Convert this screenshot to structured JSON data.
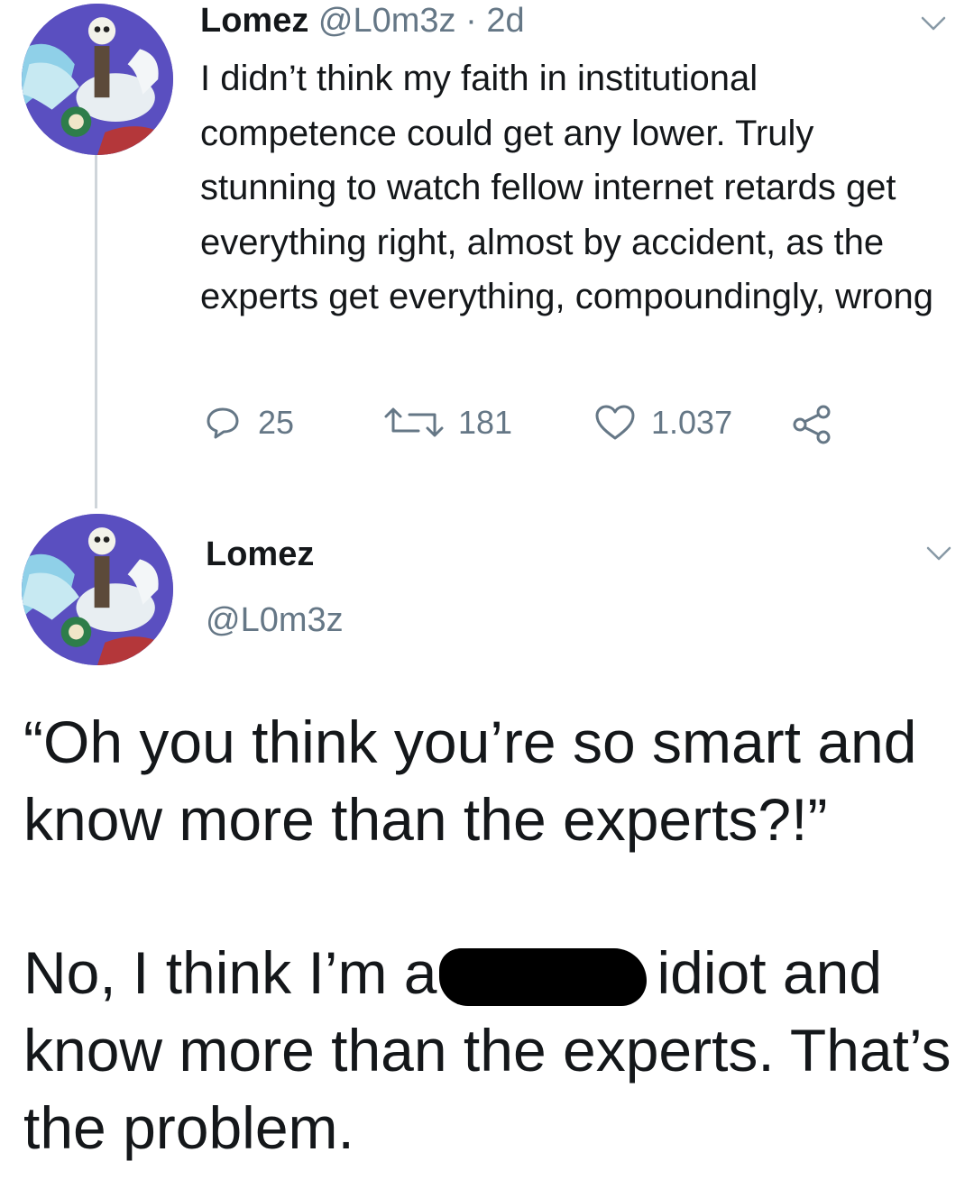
{
  "tweet": {
    "author_name": "Lomez",
    "author_handle": "@L0m3z",
    "separator": "·",
    "time": "2d",
    "text": "I didn’t think my faith in institutional competence could get any lower. Truly stunning to watch fellow internet retards get everything right, almost by accident, as the experts get everything, compoundingly, wrong",
    "replies": "25",
    "retweets": "181",
    "likes": "1.037",
    "icons": [
      "reply-icon",
      "retweet-icon",
      "like-icon",
      "share-icon",
      "chevron-down-icon"
    ]
  },
  "reply": {
    "author_name": "Lomez",
    "author_handle": "@L0m3z",
    "line1": "“Oh you think you’re so smart and know more than the experts?!”",
    "line2_before": "No, I think I’m a",
    "line2_after": "idiot and know more than the experts. That’s the problem."
  },
  "colors": {
    "text": "#14171a",
    "muted": "#657786",
    "thread_line": "#cfd5da"
  }
}
